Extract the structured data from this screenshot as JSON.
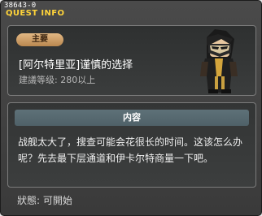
{
  "quest_id": "38643-0",
  "window_title": "QUEST INFO",
  "badge": "主要",
  "quest": {
    "name": "[阿尔特里亚]谨慎的选择",
    "level": "建議等级: 280以上"
  },
  "content": {
    "header": "内容",
    "text": "战舰太大了，搜查可能会花很长的时间。这该怎么办呢？先去最下层通道和伊卡尔特商量一下吧。"
  },
  "status": "狀態: 可開始",
  "colors": {
    "title": "#ffd43a",
    "badge": "#c99a62",
    "content_header": "#566a71"
  }
}
